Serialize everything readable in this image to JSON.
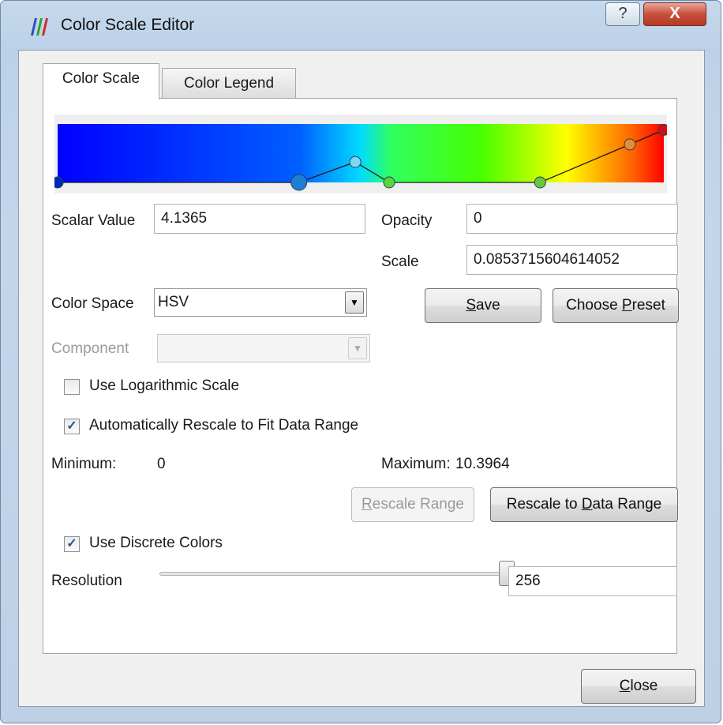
{
  "window": {
    "title": "Color Scale Editor",
    "help_glyph": "?",
    "close_glyph": "X"
  },
  "tabs": [
    {
      "label": "Color Scale",
      "active": true
    },
    {
      "label": "Color Legend",
      "active": false
    }
  ],
  "color_scale": {
    "gradient_stops": [
      {
        "offset": 0.0,
        "color": "#0000ff"
      },
      {
        "offset": 0.4,
        "color": "#0060ff"
      },
      {
        "offset": 0.5,
        "color": "#00dcff"
      },
      {
        "offset": 0.55,
        "color": "#30ff60"
      },
      {
        "offset": 0.7,
        "color": "#48ff00"
      },
      {
        "offset": 0.84,
        "color": "#ffff00"
      },
      {
        "offset": 0.95,
        "color": "#ff6000"
      },
      {
        "offset": 1.0,
        "color": "#ff0000"
      }
    ],
    "opacity_points": [
      {
        "value": 0.0,
        "opacity": 0.0,
        "color": "#0026b8",
        "selected": false
      },
      {
        "value": 0.398,
        "opacity": 0.0,
        "color": "#1f7fd6",
        "selected": true
      },
      {
        "value": 0.491,
        "opacity": 0.35,
        "color": "#7fd7f1",
        "selected": false
      },
      {
        "value": 0.547,
        "opacity": 0.0,
        "color": "#5bd63a",
        "selected": false
      },
      {
        "value": 0.796,
        "opacity": 0.0,
        "color": "#69c839",
        "selected": false
      },
      {
        "value": 0.944,
        "opacity": 0.65,
        "color": "#e88c33",
        "selected": false
      },
      {
        "value": 1.0,
        "opacity": 0.9,
        "color": "#d01010",
        "selected": false
      }
    ],
    "scalar_value_label": "Scalar Value",
    "scalar_value": "4.1365",
    "opacity_label": "Opacity",
    "opacity_value": "0",
    "scale_label": "Scale",
    "scale_value": "0.0853715604614052",
    "color_space_label": "Color Space",
    "color_space_value": "HSV",
    "save_prefix": "",
    "save_mnemonic": "S",
    "save_suffix": "ave",
    "choose_preset_prefix": "Choose ",
    "choose_preset_mnemonic": "P",
    "choose_preset_suffix": "reset",
    "component_label": "Component",
    "component_value": "",
    "log_scale_label": "Use Logarithmic Scale",
    "log_scale_checked": false,
    "auto_rescale_label": "Automatically Rescale to Fit Data Range",
    "auto_rescale_checked": true,
    "minimum_label": "Minimum:",
    "minimum_value": "0",
    "maximum_label": "Maximum:",
    "maximum_value": "10.3964",
    "rescale_range_prefix": "",
    "rescale_range_mnemonic": "R",
    "rescale_range_suffix": "escale Range",
    "rescale_data_prefix": "Rescale to ",
    "rescale_data_mnemonic": "D",
    "rescale_data_suffix": "ata Range",
    "discrete_label": "Use Discrete Colors",
    "discrete_checked": true,
    "resolution_label": "Resolution",
    "resolution_value": "256",
    "resolution_fraction": 1.0
  },
  "footer": {
    "close_prefix": "",
    "close_mnemonic": "C",
    "close_suffix": "lose"
  }
}
